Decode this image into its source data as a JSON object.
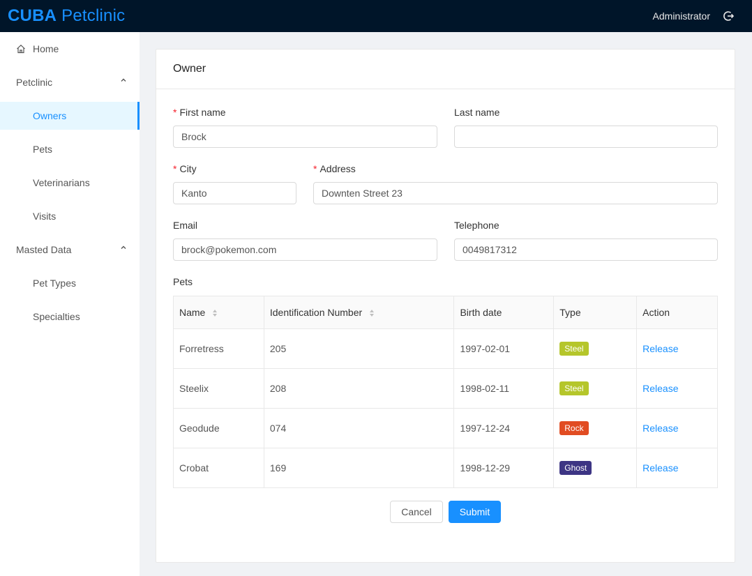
{
  "header": {
    "brand_bold": "CUBA",
    "brand_rest": "Petclinic",
    "user": "Administrator"
  },
  "sidebar": {
    "home": "Home",
    "petclinic": "Petclinic",
    "owners": "Owners",
    "pets": "Pets",
    "veterinarians": "Veterinarians",
    "visits": "Visits",
    "masted_data": "Masted Data",
    "pet_types": "Pet Types",
    "specialties": "Specialties"
  },
  "card": {
    "title": "Owner"
  },
  "form": {
    "first_name": {
      "label": "First name",
      "value": "Brock"
    },
    "last_name": {
      "label": "Last name",
      "value": ""
    },
    "city": {
      "label": "City",
      "value": "Kanto"
    },
    "address": {
      "label": "Address",
      "value": "Downten Street 23"
    },
    "email": {
      "label": "Email",
      "value": "brock@pokemon.com"
    },
    "telephone": {
      "label": "Telephone",
      "value": "0049817312"
    }
  },
  "pets": {
    "label": "Pets",
    "columns": [
      "Name",
      "Identification Number",
      "Birth date",
      "Type",
      "Action"
    ],
    "rows": [
      {
        "name": "Forretress",
        "id": "205",
        "birth": "1997-02-01",
        "type": "Steel",
        "type_color": "#b5c62b",
        "action": "Release"
      },
      {
        "name": "Steelix",
        "id": "208",
        "birth": "1998-02-11",
        "type": "Steel",
        "type_color": "#b5c62b",
        "action": "Release"
      },
      {
        "name": "Geodude",
        "id": "074",
        "birth": "1997-12-24",
        "type": "Rock",
        "type_color": "#e14c22",
        "action": "Release"
      },
      {
        "name": "Crobat",
        "id": "169",
        "birth": "1998-12-29",
        "type": "Ghost",
        "type_color": "#3d3584",
        "action": "Release"
      }
    ]
  },
  "buttons": {
    "cancel": "Cancel",
    "submit": "Submit"
  },
  "colors": {
    "header_bg": "#001529",
    "accent": "#1890ff",
    "required": "#f5222d"
  }
}
